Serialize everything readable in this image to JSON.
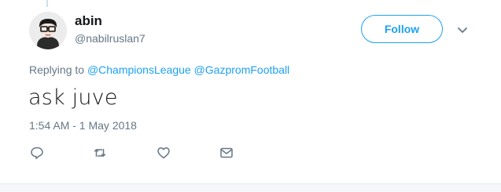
{
  "tweet": {
    "display_name": "abin",
    "username": "@nabilruslan7",
    "follow_label": "Follow",
    "replying_prefix": "Replying to",
    "reply_mentions": [
      "@ChampionsLeague",
      "@GazpromFootball"
    ],
    "text": "ask juve",
    "timestamp": "1:54 AM - 1 May 2018"
  },
  "icons": {
    "more": "chevron-down-icon",
    "actions": [
      "reply-icon",
      "retweet-icon",
      "like-icon",
      "direct-message-icon"
    ]
  },
  "colors": {
    "accent": "#1da1f2",
    "secondary_text": "#657786",
    "primary_text": "#14171a",
    "footer_bg": "#f5f8fa"
  }
}
